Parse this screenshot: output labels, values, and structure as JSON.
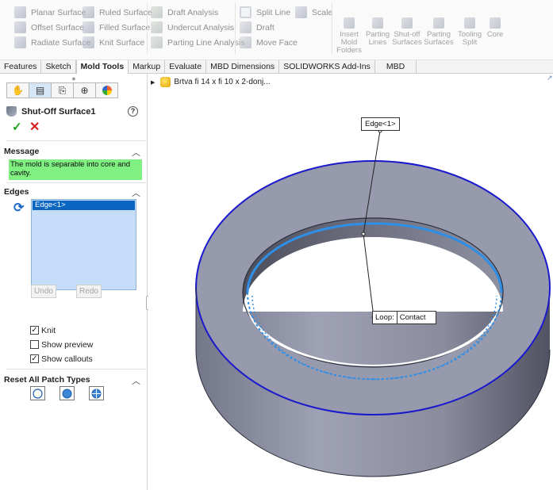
{
  "ribbon": {
    "col1": [
      "Planar Surface",
      "Offset Surface",
      "Radiate Surface"
    ],
    "col2": [
      "Ruled Surface",
      "Filled Surface",
      "Knit Surface"
    ],
    "col3": [
      "Draft Analysis",
      "Undercut Analysis",
      "Parting Line Analysis"
    ],
    "col4": [
      "Split Line",
      "Draft",
      "Move Face"
    ],
    "col4b": "Scale",
    "large": [
      {
        "label": "Insert Mold Folders"
      },
      {
        "label": "Parting Lines"
      },
      {
        "label": "Shut-off Surfaces"
      },
      {
        "label": "Parting Surfaces"
      },
      {
        "label": "Tooling Split"
      },
      {
        "label": "Core"
      }
    ]
  },
  "tabs": [
    "Features",
    "Sketch",
    "Mold Tools",
    "Markup",
    "Evaluate",
    "MBD Dimensions",
    "SOLIDWORKS Add-Ins",
    "MBD"
  ],
  "active_tab": "Mold Tools",
  "panel": {
    "title": "Shut-Off Surface1",
    "help": "?",
    "ok": "✓",
    "cancel": "✕",
    "message_header": "Message",
    "message_text": "The mold is separable into core and cavity.",
    "edges_header": "Edges",
    "edge_items": [
      "Edge<1>"
    ],
    "undo_label": "Undo",
    "redo_label": "Redo",
    "knit_label": "Knit",
    "show_preview_label": "Show preview",
    "show_callouts_label": "Show callouts",
    "reset_header": "Reset All Patch Types"
  },
  "viewport": {
    "part_name": "Brtva fi 14 x fi 10 x 2-donj...",
    "callout_edge": "Edge<1>",
    "callout_loop_a": "Loop:",
    "callout_loop_b": "Contact"
  },
  "colors": {
    "message_bg": "#80f082",
    "selection_blue": "#0b66c2",
    "edge_highlight": "#1a1acc",
    "loop_highlight": "#2f8fe6"
  }
}
